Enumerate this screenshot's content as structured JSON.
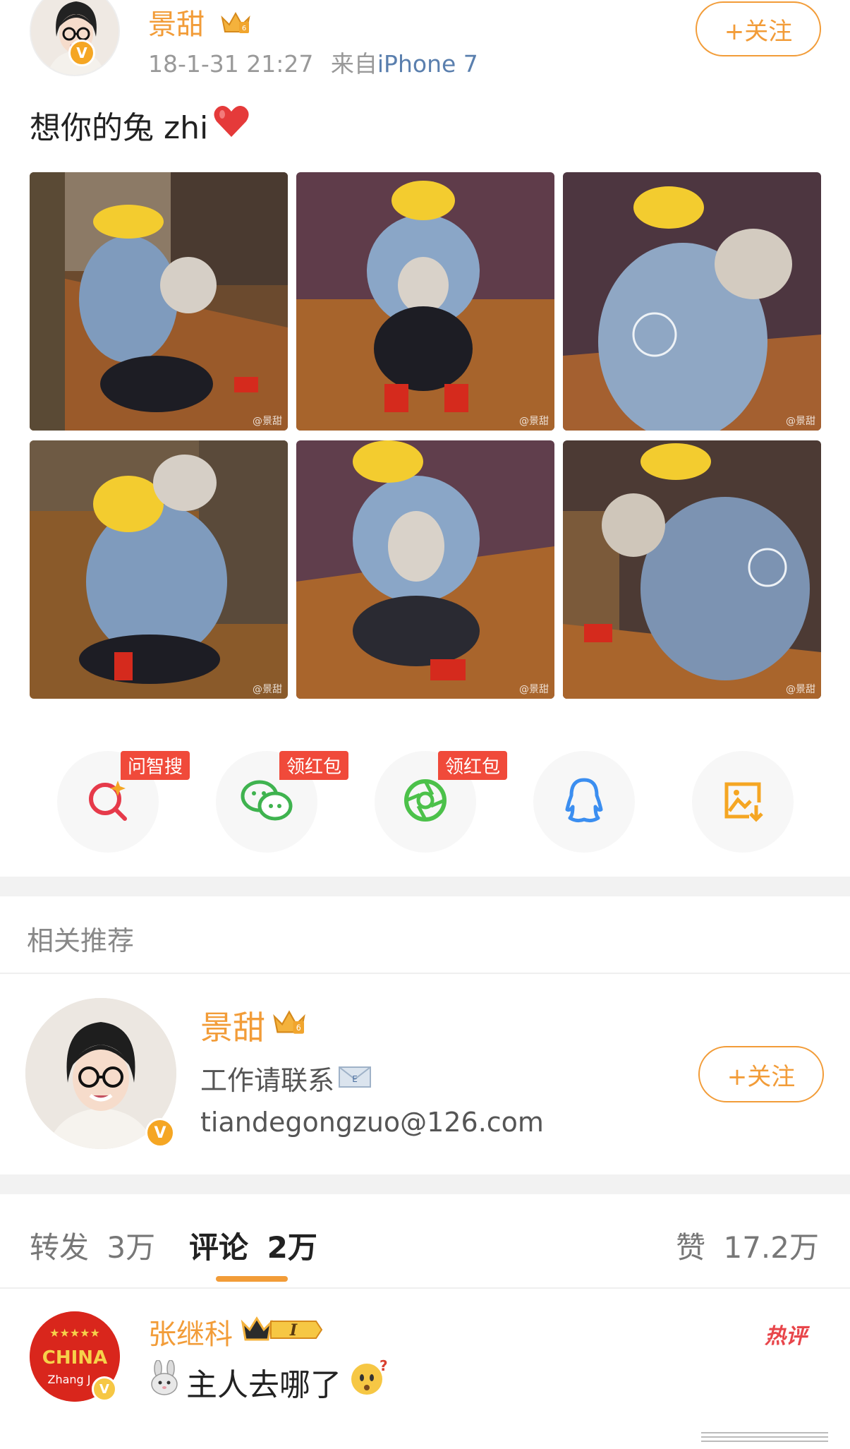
{
  "post": {
    "author": "景甜",
    "time": "18-1-31 21:27",
    "source_prefix": "来自",
    "device": "iPhone 7",
    "follow_label": "+关注",
    "text": "想你的兔 zhi",
    "watermark": "@景甜"
  },
  "share": {
    "items": [
      {
        "name": "zhisou",
        "tag": "问智搜",
        "icon": "search-sparkle-icon"
      },
      {
        "name": "wechat",
        "tag": "领红包",
        "icon": "wechat-icon"
      },
      {
        "name": "moments",
        "tag": "领红包",
        "icon": "moments-icon"
      },
      {
        "name": "qq",
        "tag": "",
        "icon": "qq-icon"
      },
      {
        "name": "save-image",
        "tag": "",
        "icon": "save-image-icon"
      }
    ]
  },
  "recommend": {
    "section_title": "相关推荐",
    "name": "景甜",
    "desc": "工作请联系",
    "email": "tiandegongzuo@126.com",
    "follow_label": "+关注"
  },
  "tabs": {
    "repost_label": "转发",
    "repost_count": "3万",
    "comment_label": "评论",
    "comment_count": "2万",
    "like_label": "赞",
    "like_count": "17.2万"
  },
  "comment": {
    "author": "张继科",
    "level": "I",
    "text": "主人去哪了",
    "hot_label": "热评",
    "avatar_top_text": "★★★★★",
    "avatar_mid_text": "CHINA",
    "avatar_bottom_text": "Zhang J"
  },
  "colors": {
    "accent": "#f29c38",
    "link": "#5a7fae",
    "red": "#f04a3a"
  }
}
